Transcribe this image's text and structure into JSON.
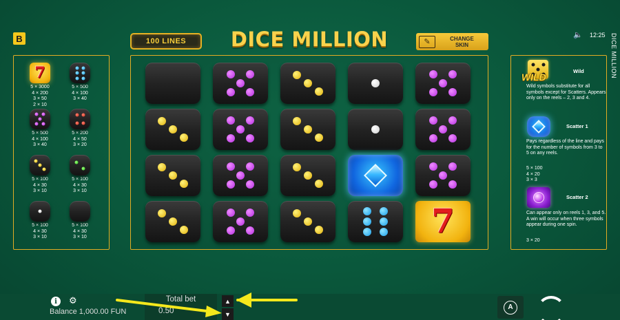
{
  "top": {
    "badge": "B",
    "lines_label": "100 LINES",
    "title": "DICE MILLION",
    "change_skin_line1": "CHANGE",
    "change_skin_line2": "SKIN",
    "time": "12:25",
    "side_title": "DICE MILLION"
  },
  "paytable": [
    {
      "symbol": "seven",
      "pays": [
        "5 × 3000",
        "4 × 200",
        "3 × 50",
        "2 × 10"
      ]
    },
    {
      "symbol": "blue-6",
      "pays": [
        "5 × 500",
        "4 × 100",
        "3 × 40"
      ]
    },
    {
      "symbol": "purple-5",
      "pays": [
        "5 × 500",
        "4 × 100",
        "3 × 40"
      ]
    },
    {
      "symbol": "red-4",
      "pays": [
        "5 × 200",
        "4 × 50",
        "3 × 20"
      ]
    },
    {
      "symbol": "yellow-3",
      "pays": [
        "5 × 100",
        "4 × 30",
        "3 × 10"
      ]
    },
    {
      "symbol": "green-2",
      "pays": [
        "5 × 100",
        "4 × 30",
        "3 × 10"
      ]
    },
    {
      "symbol": "white-1",
      "pays": [
        "5 × 100",
        "4 × 30",
        "3 × 10"
      ]
    },
    {
      "symbol": "blank",
      "pays": [
        "5 × 100",
        "4 × 30",
        "3 × 10"
      ]
    }
  ],
  "reels": [
    [
      "blank",
      "purple-5",
      "yellow-3",
      "white-1",
      "purple-5"
    ],
    [
      "yellow-3",
      "purple-5",
      "yellow-3",
      "white-1",
      "purple-5"
    ],
    [
      "yellow-3",
      "purple-5",
      "yellow-3",
      "blue-gem",
      "purple-5"
    ],
    [
      "yellow-3",
      "purple-5",
      "yellow-3",
      "blue-6",
      "seven"
    ]
  ],
  "info": {
    "wild_label": "WILD",
    "wild_head": "Wild",
    "wild_text": "Wild symbols substitute for all symbols except for Scatters. Appears only on the reels – 2, 3 and 4.",
    "scatter1_head": "Scatter 1",
    "scatter1_text": "Pays regardless of the line and pays for the number of symbols from 3 to 5 on any reels.",
    "scatter1_pays": [
      "5 × 100",
      "4 × 20",
      "3 × 3"
    ],
    "scatter2_head": "Scatter 2",
    "scatter2_text": "Can appear only on reels 1, 3, and 5. A win will occur when three symbols appear during one spin.",
    "scatter2_pays": [
      "3 × 20"
    ]
  },
  "bottom": {
    "balance": "Balance 1,000.00 FUN",
    "total_bet_label": "Total bet",
    "total_bet_value": "0.50",
    "autoplay_label": "A"
  },
  "colors": {
    "background": "#0a573b",
    "frame_gold": "#e4ad24",
    "title_gold": "#f8d24c",
    "annotation_arrow": "#f4e81c"
  }
}
